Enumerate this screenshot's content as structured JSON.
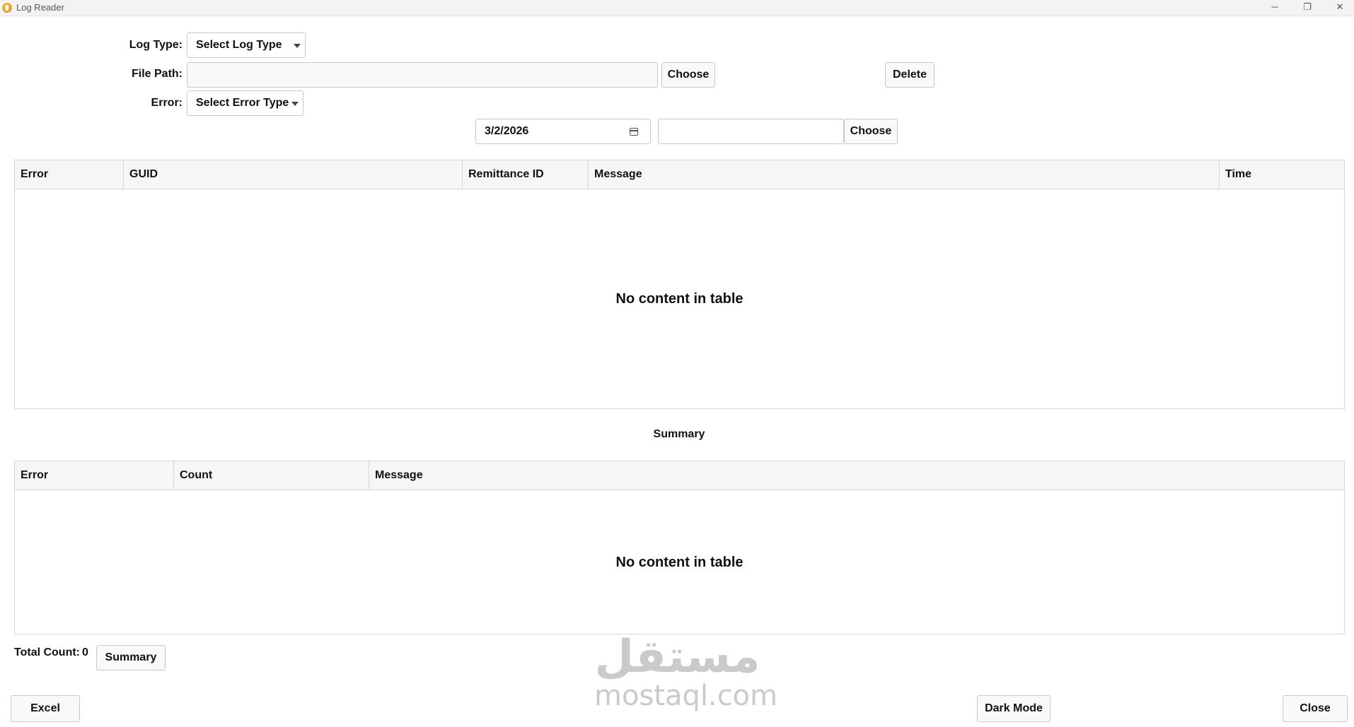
{
  "window": {
    "title": "Log Reader",
    "minimize_glyph": "─",
    "maximize_glyph": "❐",
    "close_glyph": "✕"
  },
  "filters": {
    "log_type_label": "Log Type:",
    "log_type_value": "Select Log Type",
    "file_path_label": "File Path:",
    "file_path_value": "",
    "choose_label": "Choose",
    "delete_label": "Delete",
    "error_label": "Error:",
    "error_value": "Select Error Type",
    "date_value": "3/2/2026",
    "date_extra_value": "",
    "choose2_label": "Choose"
  },
  "log_table": {
    "columns": [
      "Error",
      "GUID",
      "Remittance ID",
      "Message",
      "Time"
    ],
    "empty_text": "No content in table"
  },
  "summary": {
    "title": "Summary",
    "columns": [
      "Error",
      "Count",
      "Message"
    ],
    "empty_text": "No content in table"
  },
  "footer": {
    "total_count_label": "Total Count:",
    "total_count_value": "0",
    "summary_button": "Summary",
    "excel_button": "Excel",
    "dark_mode_button": "Dark Mode",
    "close_button": "Close"
  },
  "watermark": {
    "arabic": "مستقل",
    "latin": "mostaql.com"
  }
}
